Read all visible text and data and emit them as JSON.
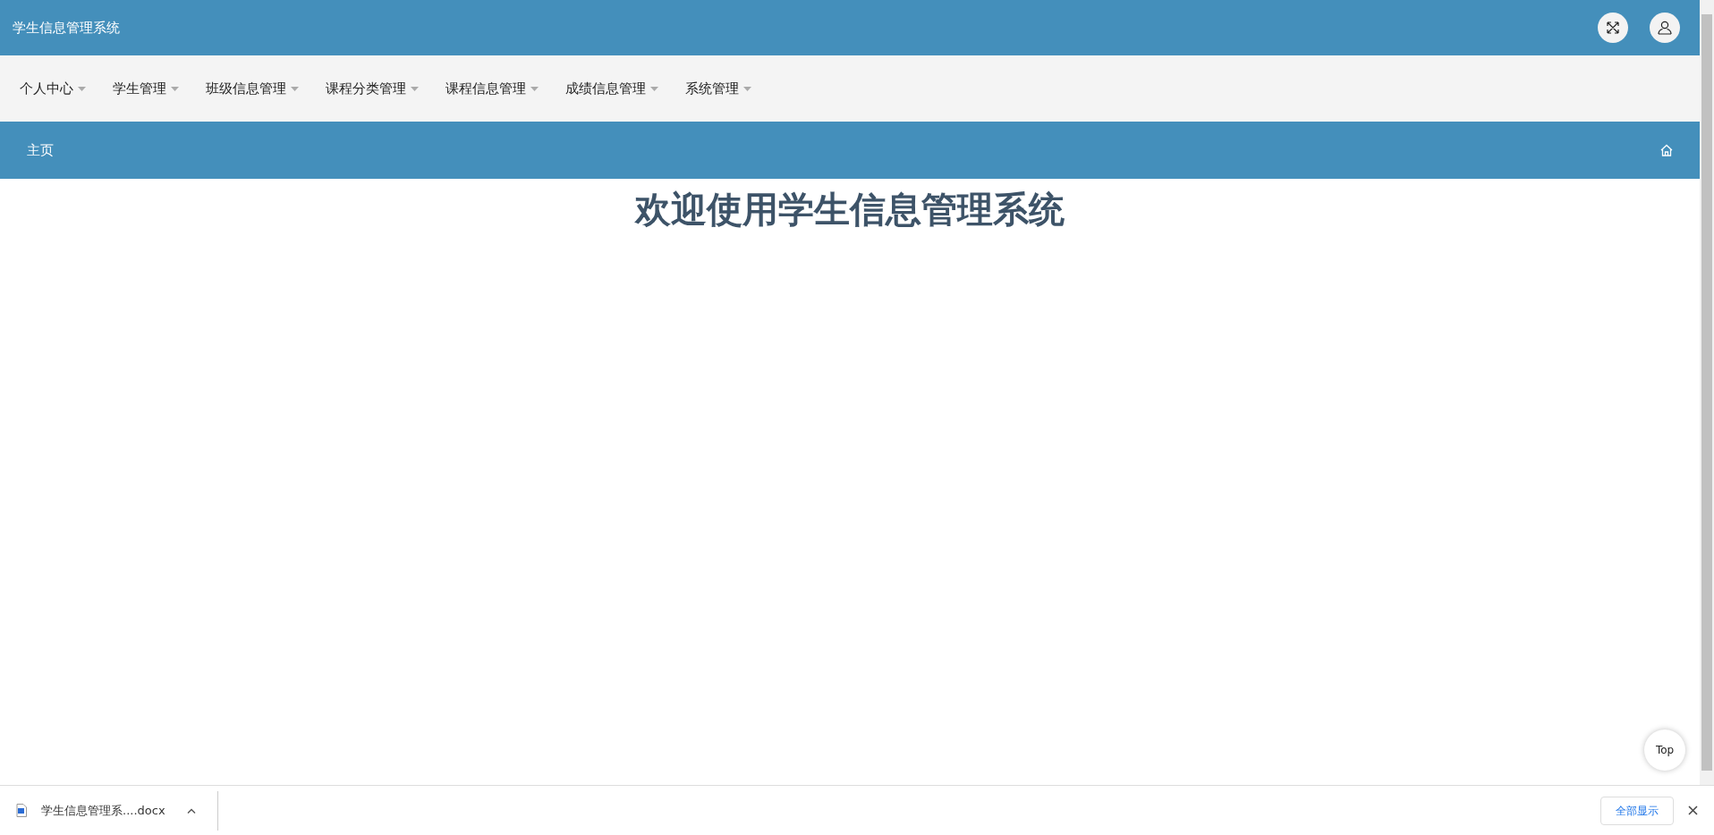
{
  "header": {
    "title": "学生信息管理系统"
  },
  "menu": [
    {
      "label": "个人中心"
    },
    {
      "label": "学生管理"
    },
    {
      "label": "班级信息管理"
    },
    {
      "label": "课程分类管理"
    },
    {
      "label": "课程信息管理"
    },
    {
      "label": "成绩信息管理"
    },
    {
      "label": "系统管理"
    }
  ],
  "breadcrumb": {
    "label": "主页"
  },
  "main": {
    "heading": "欢迎使用学生信息管理系统"
  },
  "back_to_top": {
    "label": "Top"
  },
  "download_bar": {
    "file_name": "学生信息管理系....docx",
    "show_all": "全部显示"
  }
}
